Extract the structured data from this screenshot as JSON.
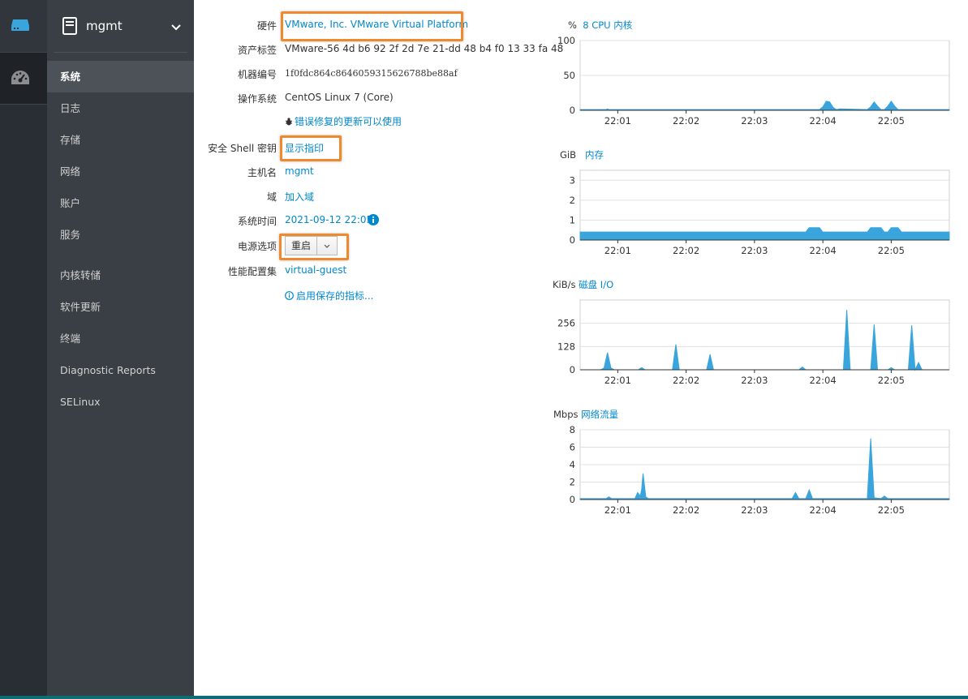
{
  "rail": {
    "items": [
      {
        "icon": "server-icon"
      },
      {
        "icon": "dashboard-icon"
      }
    ]
  },
  "host": {
    "name": "mgmt",
    "icon": "server-box-icon",
    "menu_icon": "chevron-down-icon"
  },
  "nav": {
    "items": [
      {
        "label": "系统",
        "active": true
      },
      {
        "label": "日志"
      },
      {
        "label": "存储"
      },
      {
        "label": "网络"
      },
      {
        "label": "账户"
      },
      {
        "label": "服务"
      },
      {
        "label": "内核转储"
      },
      {
        "label": "软件更新"
      },
      {
        "label": "终端"
      },
      {
        "label": "Diagnostic Reports"
      },
      {
        "label": "SELinux"
      }
    ]
  },
  "system": {
    "hardware_label": "硬件",
    "hardware_value": "VMware, Inc. VMware Virtual Platform",
    "asset_label": "资产标签",
    "asset_value": "VMware-56 4d b6 92 2f 2d 7e 21-dd 48 b4 f0 13 33 fa 48",
    "machine_label": "机器编号",
    "machine_value": "1f0fdc864c8646059315626788be88af",
    "os_label": "操作系统",
    "os_value": "CentOS Linux 7 (Core)",
    "updates_link": "错误修复的更新可以使用",
    "ssh_label": "安全 Shell 密钥",
    "ssh_link": "显示指印",
    "hostname_label": "主机名",
    "hostname_value": "mgmt",
    "domain_label": "域",
    "domain_link": "加入域",
    "time_label": "系统时间",
    "time_value": "2021-09-12 22:05",
    "power_label": "电源选项",
    "power_button": "重启",
    "profile_label": "性能配置集",
    "profile_value": "virtual-guest",
    "metrics_link": "启用保存的指标..."
  },
  "chart_data": [
    {
      "type": "area",
      "unit": "%",
      "title": "8 CPU 内核",
      "ylim": [
        0,
        100
      ],
      "yticks": [
        0,
        50,
        100
      ],
      "xticks": [
        "22:01",
        "22:02",
        "22:03",
        "22:04",
        "22:05"
      ],
      "x": [
        0,
        0.38,
        0.4,
        0.42,
        3.5,
        3.55,
        3.6,
        3.65,
        3.7,
        3.75,
        3.8,
        4.2,
        4.25,
        4.3,
        4.35,
        4.4,
        4.45,
        4.5,
        4.55,
        4.6,
        4.65,
        4.7,
        5.4
      ],
      "values": [
        1,
        1,
        2,
        1,
        1,
        5,
        13,
        12,
        4,
        1,
        2,
        1,
        5,
        12,
        6,
        1,
        1,
        6,
        13,
        6,
        1,
        1,
        1
      ]
    },
    {
      "type": "area",
      "unit": "GiB",
      "title": "内存",
      "ylim": [
        0,
        3.5
      ],
      "yticks": [
        0,
        1,
        2,
        3
      ],
      "xticks": [
        "22:01",
        "22:02",
        "22:03",
        "22:04",
        "22:05"
      ],
      "x": [
        0,
        3.3,
        3.35,
        3.4,
        3.5,
        3.55,
        3.6,
        4.2,
        4.25,
        4.3,
        4.4,
        4.45,
        4.5,
        4.55,
        4.65,
        4.7,
        5.4
      ],
      "values": [
        0.4,
        0.4,
        0.62,
        0.62,
        0.62,
        0.4,
        0.4,
        0.4,
        0.62,
        0.62,
        0.62,
        0.4,
        0.4,
        0.62,
        0.62,
        0.4,
        0.4
      ]
    },
    {
      "type": "area",
      "unit": "KiB/s",
      "title": "磁盘 I/O",
      "ylim": [
        0,
        384
      ],
      "yticks": [
        0,
        128,
        256
      ],
      "xticks": [
        "22:01",
        "22:02",
        "22:03",
        "22:04",
        "22:05"
      ],
      "x": [
        0,
        0.3,
        0.35,
        0.4,
        0.45,
        0.5,
        0.85,
        0.9,
        0.95,
        1.35,
        1.4,
        1.45,
        1.85,
        1.9,
        1.95,
        3.2,
        3.25,
        3.3,
        3.85,
        3.9,
        3.95,
        4.25,
        4.3,
        4.35,
        4.5,
        4.55,
        4.6,
        4.8,
        4.85,
        4.9,
        4.95,
        5.0,
        5.05,
        5.4
      ],
      "values": [
        0,
        0,
        10,
        95,
        10,
        0,
        0,
        12,
        0,
        0,
        140,
        0,
        0,
        85,
        0,
        0,
        15,
        0,
        0,
        330,
        0,
        0,
        250,
        0,
        0,
        12,
        0,
        0,
        245,
        0,
        40,
        0,
        0,
        0
      ]
    },
    {
      "type": "area",
      "unit": "Mbps",
      "title": "网络流量",
      "ylim": [
        0,
        8
      ],
      "yticks": [
        0,
        2,
        4,
        6,
        8
      ],
      "xticks": [
        "22:01",
        "22:02",
        "22:03",
        "22:04",
        "22:05"
      ],
      "x": [
        0,
        0.38,
        0.42,
        0.46,
        0.8,
        0.84,
        0.88,
        0.9,
        0.92,
        0.96,
        1.0,
        3.1,
        3.15,
        3.2,
        3.3,
        3.35,
        3.4,
        4.2,
        4.25,
        4.3,
        4.4,
        4.45,
        4.5,
        5.4
      ],
      "values": [
        0.1,
        0.1,
        0.3,
        0.1,
        0.1,
        0.8,
        0.4,
        1.2,
        3.0,
        0.3,
        0.1,
        0.1,
        0.8,
        0.1,
        0.1,
        1.1,
        0.1,
        0.1,
        7.0,
        0.2,
        0.1,
        0.4,
        0.1,
        0.1
      ]
    }
  ]
}
